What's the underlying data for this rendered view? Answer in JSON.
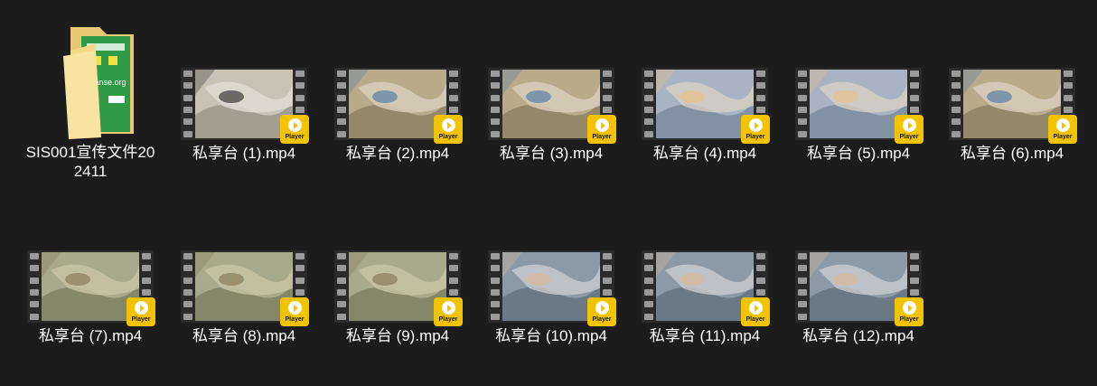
{
  "colors": {
    "background": "#1c1c1c",
    "badge": "#f4c300",
    "text": "#ffffff"
  },
  "folder": {
    "name": "SIS001宣传文件202411",
    "cover_lines": [
      "wanse.org"
    ]
  },
  "badge_label": "Player",
  "files": [
    {
      "name": "私享台 (1).mp4",
      "scene": "a"
    },
    {
      "name": "私享台 (2).mp4",
      "scene": "b"
    },
    {
      "name": "私享台 (3).mp4",
      "scene": "b"
    },
    {
      "name": "私享台 (4).mp4",
      "scene": "c"
    },
    {
      "name": "私享台 (5).mp4",
      "scene": "c"
    },
    {
      "name": "私享台 (6).mp4",
      "scene": "b"
    },
    {
      "name": "私享台 (7).mp4",
      "scene": "d"
    },
    {
      "name": "私享台 (8).mp4",
      "scene": "d"
    },
    {
      "name": "私享台 (9).mp4",
      "scene": "d"
    },
    {
      "name": "私享台 (10).mp4",
      "scene": "e"
    },
    {
      "name": "私享台 (11).mp4",
      "scene": "e"
    },
    {
      "name": "私享台 (12).mp4",
      "scene": "e"
    }
  ]
}
